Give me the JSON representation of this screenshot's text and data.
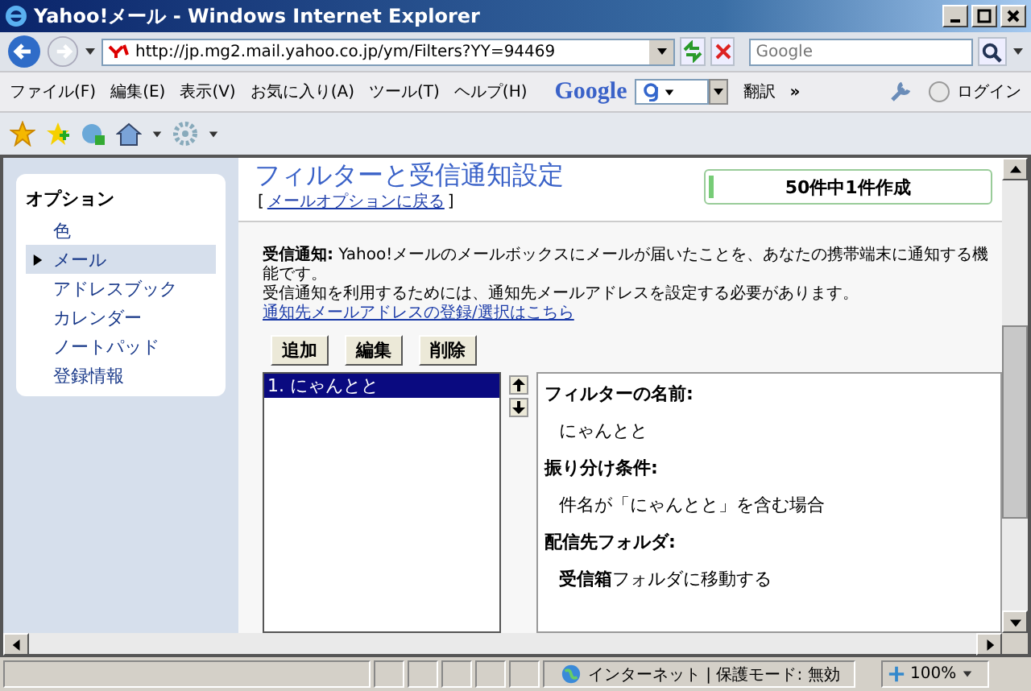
{
  "window": {
    "title": "Yahoo!メール - Windows Internet Explorer"
  },
  "address_bar": {
    "url": "http://jp.mg2.mail.yahoo.co.jp/ym/Filters?YY=94469",
    "search_placeholder": "Google"
  },
  "menu": [
    "ファイル(F)",
    "編集(E)",
    "表示(V)",
    "お気に入り(A)",
    "ツール(T)",
    "ヘルプ(H)"
  ],
  "google_toolbar": {
    "logo": "Google",
    "translate": "翻訳",
    "more": "»",
    "login": "ログイン"
  },
  "sidebar": {
    "heading": "オプション",
    "items": [
      {
        "label": "色",
        "selected": false
      },
      {
        "label": "メール",
        "selected": true
      },
      {
        "label": "アドレスブック",
        "selected": false
      },
      {
        "label": "カレンダー",
        "selected": false
      },
      {
        "label": "ノートパッド",
        "selected": false
      },
      {
        "label": "登録情報",
        "selected": false
      }
    ]
  },
  "page": {
    "title": "フィルターと受信通知設定",
    "back_link_open": "[",
    "back_link": "メールオプションに戻る",
    "back_link_close": "]",
    "quota": {
      "label": "50件中1件作成",
      "level": 0.02
    },
    "description": "**受信通知:** Yahoo!メールのメールボックスにメールが届いたことを、あなたの携帯端末に通知する機能です。",
    "note": "受信通知を利用するためには、通知先メールアドレスを設定する必要があります。",
    "register_link": "通知先メールアドレスの登録/選択はこちら",
    "buttons": [
      "追加",
      "編集",
      "削除"
    ],
    "filters": [
      {
        "label": "1. にゃんとと",
        "selected": true
      }
    ],
    "details": [
      {
        "kind": "heading",
        "text": "フィルターの名前:"
      },
      {
        "kind": "value",
        "text": "にゃんとと"
      },
      {
        "kind": "heading",
        "text": "振り分け条件:"
      },
      {
        "kind": "value",
        "text": "件名が「にゃんとと」を含む場合"
      },
      {
        "kind": "heading",
        "text": "配信先フォルダ:"
      },
      {
        "kind": "value",
        "text": "**受信箱**フォルダに移動する"
      }
    ]
  },
  "status_bar": {
    "zone": "インターネット | 保護モード: 無効",
    "zoom": "100%"
  }
}
